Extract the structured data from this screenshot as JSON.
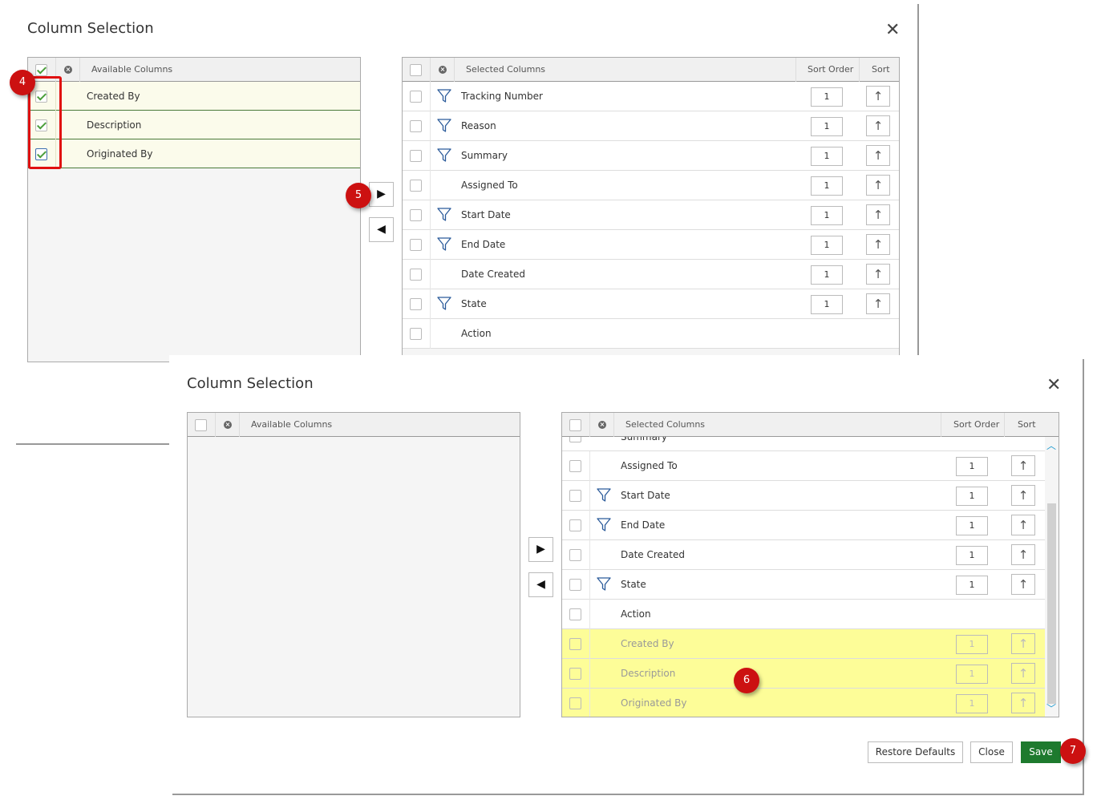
{
  "top": {
    "title": "Column Selection",
    "available_header": "Available Columns",
    "available_items": [
      "Created By",
      "Description",
      "Originated By"
    ],
    "selected_header": "Selected Columns",
    "sort_order_header": "Sort Order",
    "sort_header": "Sort",
    "selected_items": [
      {
        "label": "Tracking Number",
        "filter": true,
        "sort_order": "1",
        "sort": true
      },
      {
        "label": "Reason",
        "filter": true,
        "sort_order": "1",
        "sort": true
      },
      {
        "label": "Summary",
        "filter": true,
        "sort_order": "1",
        "sort": true
      },
      {
        "label": "Assigned To",
        "filter": false,
        "sort_order": "1",
        "sort": true
      },
      {
        "label": "Start Date",
        "filter": true,
        "sort_order": "1",
        "sort": true
      },
      {
        "label": "End Date",
        "filter": true,
        "sort_order": "1",
        "sort": true
      },
      {
        "label": "Date Created",
        "filter": false,
        "sort_order": "1",
        "sort": true
      },
      {
        "label": "State",
        "filter": true,
        "sort_order": "1",
        "sort": true
      },
      {
        "label": "Action",
        "filter": false,
        "sort_order": "",
        "sort": false
      }
    ]
  },
  "bottom": {
    "title": "Column Selection",
    "available_header": "Available Columns",
    "selected_header": "Selected Columns",
    "sort_order_header": "Sort Order",
    "sort_header": "Sort",
    "partial_item": "Summary",
    "selected_items": [
      {
        "label": "Assigned To",
        "filter": false,
        "sort_order": "1",
        "sort": true,
        "highlight": false
      },
      {
        "label": "Start Date",
        "filter": true,
        "sort_order": "1",
        "sort": true,
        "highlight": false
      },
      {
        "label": "End Date",
        "filter": true,
        "sort_order": "1",
        "sort": true,
        "highlight": false
      },
      {
        "label": "Date Created",
        "filter": false,
        "sort_order": "1",
        "sort": true,
        "highlight": false
      },
      {
        "label": "State",
        "filter": true,
        "sort_order": "1",
        "sort": true,
        "highlight": false
      },
      {
        "label": "Action",
        "filter": false,
        "sort_order": "",
        "sort": false,
        "highlight": false
      },
      {
        "label": "Created By",
        "filter": false,
        "sort_order": "1",
        "sort": true,
        "highlight": true
      },
      {
        "label": "Description",
        "filter": false,
        "sort_order": "1",
        "sort": true,
        "highlight": true
      },
      {
        "label": "Originated By",
        "filter": false,
        "sort_order": "1",
        "sort": true,
        "highlight": true
      }
    ],
    "buttons": {
      "restore": "Restore Defaults",
      "close": "Close",
      "save": "Save"
    }
  },
  "badges": [
    "4",
    "5",
    "6",
    "7"
  ],
  "icons": {
    "close": "close-icon",
    "filter": "filter-icon",
    "sort_up": "sort-arrow-up-icon",
    "move_right": "move-right-icon",
    "move_left": "move-left-icon",
    "clear": "clear-x-icon"
  },
  "colors": {
    "highlight": "#fdfd98",
    "badge": "#cc1111",
    "save": "#1e7a2e",
    "check": "#4a9e3a"
  }
}
